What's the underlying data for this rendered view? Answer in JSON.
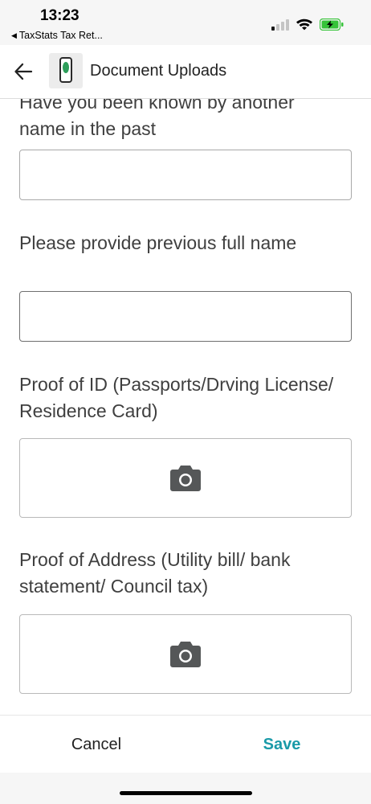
{
  "status_bar": {
    "time": "13:23",
    "back_app": "TaxStats Tax Ret...",
    "battery_color": "#36c339"
  },
  "header": {
    "title": "Document Uploads",
    "back_icon": "arrow-left-icon",
    "logo_icon": "app-logo-icon"
  },
  "form": {
    "fields": [
      {
        "label": "Have you been known by another name in the past",
        "value": ""
      },
      {
        "label": "Please provide previous full name",
        "value": ""
      }
    ],
    "uploads": [
      {
        "label": "Proof of ID (Passports/Drving License/ Residence Card)",
        "icon": "camera-icon"
      },
      {
        "label": "Proof of Address (Utility bill/ bank statement/ Council tax)",
        "icon": "camera-icon"
      }
    ]
  },
  "footer": {
    "cancel_label": "Cancel",
    "save_label": "Save",
    "accent_color": "#1a9aa8"
  }
}
